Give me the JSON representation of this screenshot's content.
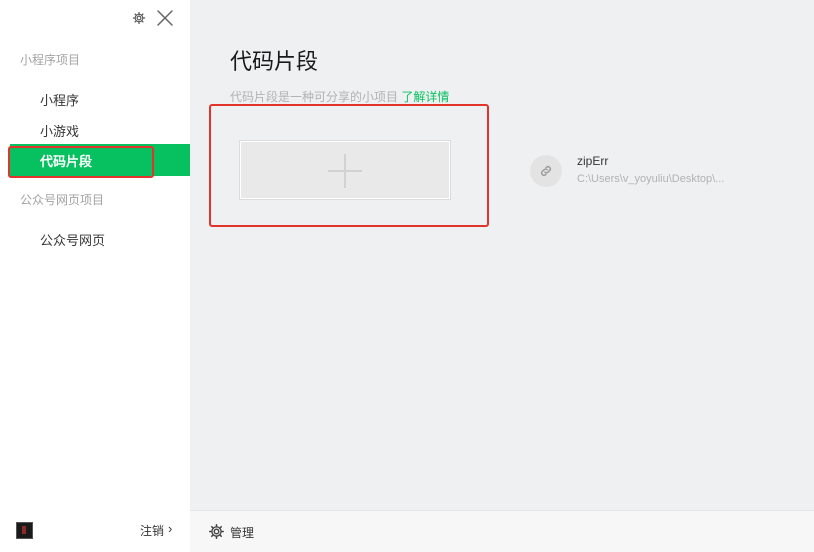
{
  "sidebar": {
    "section_mini": "小程序项目",
    "items": [
      {
        "label": "小程序"
      },
      {
        "label": "小游戏"
      },
      {
        "label": "代码片段"
      }
    ],
    "section_official": "公众号网页项目",
    "official_items": [
      {
        "label": "公众号网页"
      }
    ],
    "logout_label": "注销",
    "logout_chevron": "›"
  },
  "main": {
    "title": "代码片段",
    "description": "代码片段是一种可分享的小项目",
    "learn_more": "了解详情",
    "projects": [
      {
        "name": "zipErr",
        "path": "C:\\Users\\v_yoyuliu\\Desktop\\..."
      }
    ]
  },
  "bottom": {
    "manage_label": "管理"
  },
  "colors": {
    "accent": "#07c160",
    "highlight": "#e3332d"
  }
}
